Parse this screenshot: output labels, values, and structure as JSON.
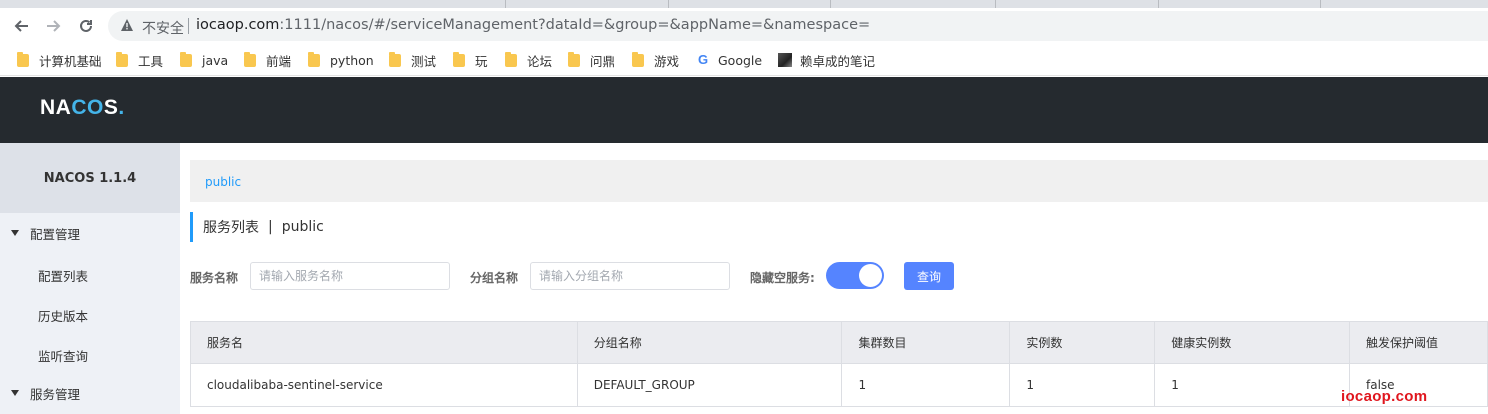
{
  "browser": {
    "insecure_label": "不安全",
    "url_host": "iocaop.com",
    "url_rest": ":1111/nacos/#/serviceManagement?dataId=&group=&appName=&namespace=",
    "bookmarks": [
      {
        "label": "计算机基础",
        "icon": "folder-icon"
      },
      {
        "label": "工具",
        "icon": "folder-icon"
      },
      {
        "label": "java",
        "icon": "folder-icon"
      },
      {
        "label": "前端",
        "icon": "folder-icon"
      },
      {
        "label": "python",
        "icon": "folder-icon"
      },
      {
        "label": "测试",
        "icon": "folder-icon"
      },
      {
        "label": "玩",
        "icon": "folder-icon"
      },
      {
        "label": "论坛",
        "icon": "folder-icon"
      },
      {
        "label": "问鼎",
        "icon": "folder-icon"
      },
      {
        "label": "游戏",
        "icon": "folder-icon"
      },
      {
        "label": "Google",
        "icon": "google-icon"
      },
      {
        "label": "赖卓成的笔记",
        "icon": "avatar-icon"
      }
    ]
  },
  "header": {
    "logo_pre": "NA",
    "logo_c": "C",
    "logo_o": "O",
    "logo_post": "S",
    "logo_dot": "."
  },
  "sidebar": {
    "title": "NACOS 1.1.4",
    "groups": [
      {
        "label": "配置管理",
        "items": [
          "配置列表",
          "历史版本",
          "监听查询"
        ]
      },
      {
        "label": "服务管理",
        "items": []
      }
    ]
  },
  "main": {
    "namespace": "public",
    "title": "服务列表",
    "title_sep": "|",
    "title_namespace": "public",
    "filters": {
      "service_name_label": "服务名称",
      "service_name_placeholder": "请输入服务名称",
      "group_name_label": "分组名称",
      "group_name_placeholder": "请输入分组名称",
      "hide_empty_label": "隐藏空服务:",
      "hide_empty_on": true,
      "query_label": "查询"
    },
    "table": {
      "columns": [
        "服务名",
        "分组名称",
        "集群数目",
        "实例数",
        "健康实例数",
        "触发保护阈值"
      ],
      "rows": [
        [
          "cloudalibaba-sentinel-service",
          "DEFAULT_GROUP",
          "1",
          "1",
          "1",
          "false"
        ]
      ]
    }
  },
  "watermark": "iocaop.com",
  "colors": {
    "accent": "#5584ff",
    "link": "#209bfa",
    "header_bg": "#252a2f",
    "watermark": "#e0161e"
  }
}
